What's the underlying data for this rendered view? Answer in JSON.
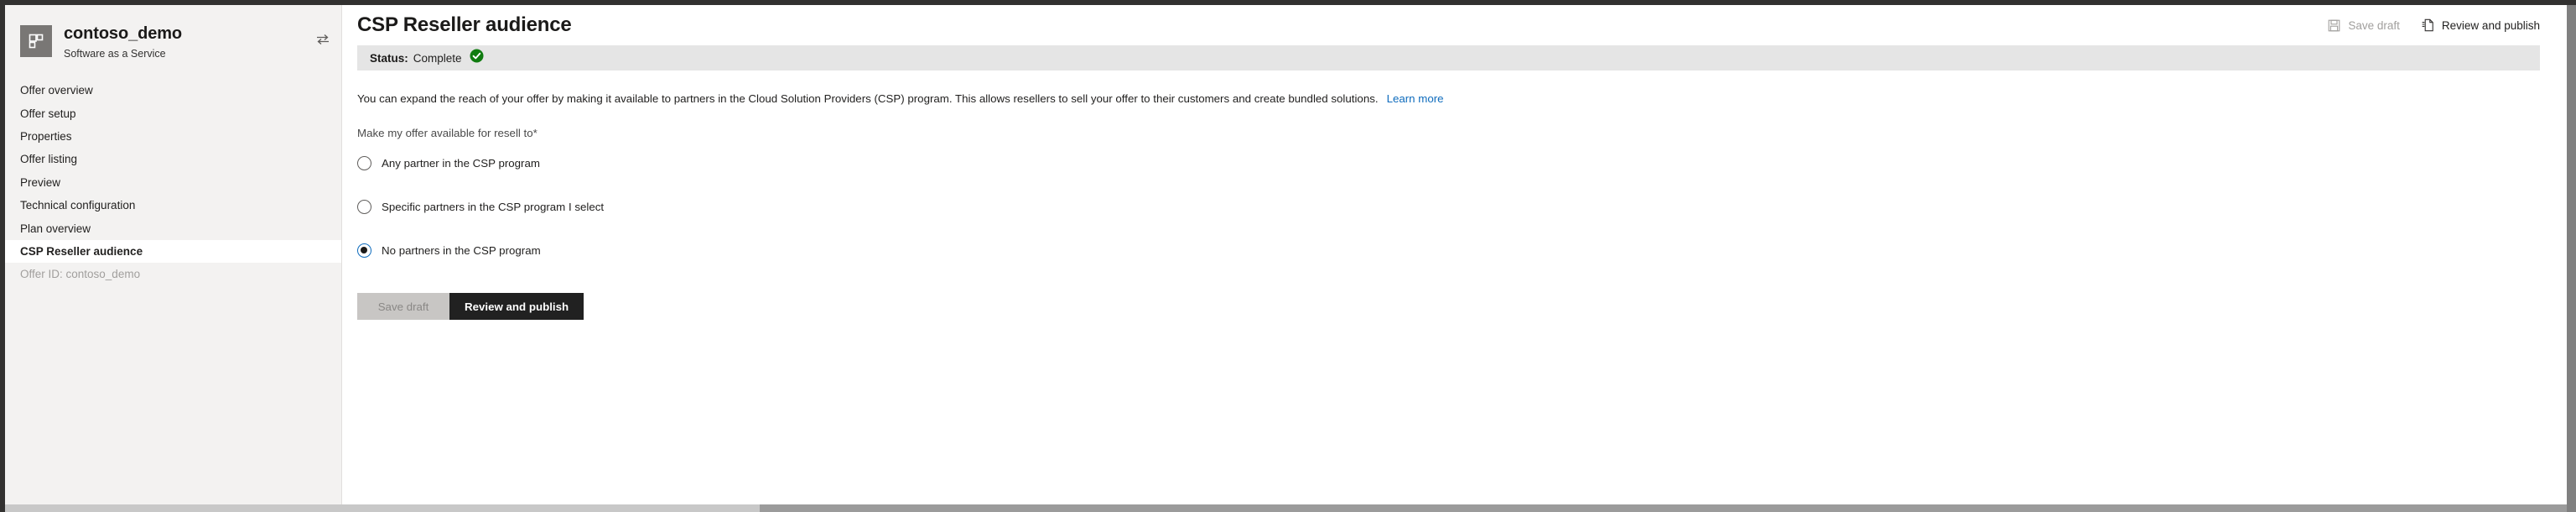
{
  "sidebar": {
    "app_icon": "grid-tile-icon",
    "app_name": "contoso_demo",
    "app_subtitle": "Software as a Service",
    "switch_icon": "swap-offer-icon",
    "items": [
      {
        "label": "Offer overview",
        "state": "normal"
      },
      {
        "label": "Offer setup",
        "state": "normal"
      },
      {
        "label": "Properties",
        "state": "normal"
      },
      {
        "label": "Offer listing",
        "state": "normal"
      },
      {
        "label": "Preview",
        "state": "normal"
      },
      {
        "label": "Technical configuration",
        "state": "normal"
      },
      {
        "label": "Plan overview",
        "state": "normal"
      },
      {
        "label": "CSP Reseller audience",
        "state": "active"
      },
      {
        "label": "Offer ID: contoso_demo",
        "state": "disabled"
      }
    ]
  },
  "header": {
    "title": "CSP Reseller audience",
    "actions": [
      {
        "label": "Save draft",
        "icon": "save-disk-icon",
        "state": "disabled"
      },
      {
        "label": "Review and publish",
        "icon": "publish-page-icon",
        "state": "enabled"
      }
    ]
  },
  "status": {
    "label": "Status:",
    "value": "Complete",
    "icon": "green-check-circle-icon",
    "color": "#107C10"
  },
  "main": {
    "description": "You can expand the reach of your offer by making it available to partners in the Cloud Solution Providers (CSP) program. This allows resellers to sell your offer to their customers and create bundled solutions.",
    "learn_more_label": "Learn more",
    "field_label": "Make my offer available for resell to",
    "required_mark": "*",
    "options": [
      {
        "label": "Any partner in the CSP program",
        "selected": false
      },
      {
        "label": "Specific partners in the CSP program I select",
        "selected": false
      },
      {
        "label": "No partners in the CSP program",
        "selected": true
      }
    ]
  },
  "footer": {
    "save_draft_label": "Save draft",
    "review_publish_label": "Review and publish"
  },
  "colors": {
    "accent_link": "#0f6cbd",
    "status_green": "#107C10",
    "primary_button": "#212121",
    "sidebar_bg": "#f3f2f1",
    "status_bar_bg": "#e5e5e5"
  }
}
